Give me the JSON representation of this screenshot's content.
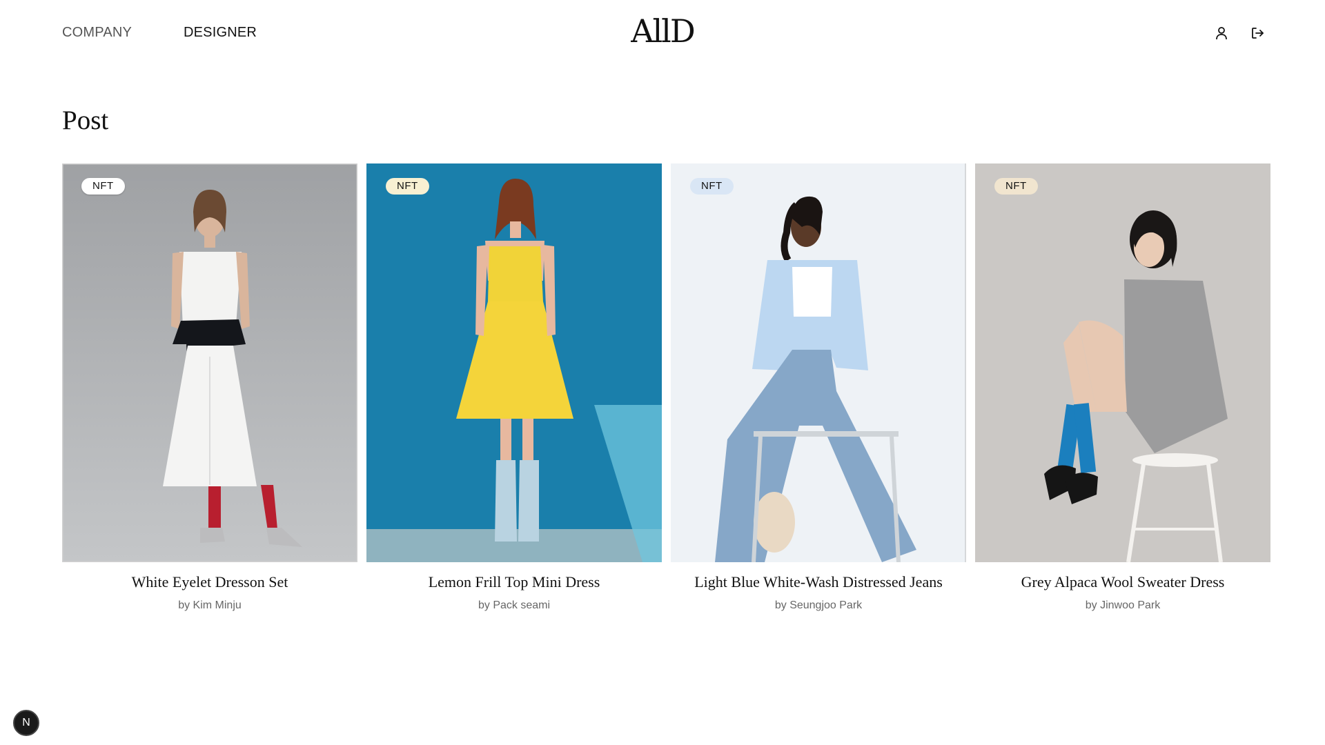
{
  "header": {
    "nav": [
      {
        "label": "COMPANY"
      },
      {
        "label": "DESIGNER"
      }
    ],
    "logo": "AllD",
    "icons": [
      "user-icon",
      "logout-icon"
    ]
  },
  "main": {
    "title": "Post",
    "posts": [
      {
        "badge": "NFT",
        "title": "White Eyelet Dresson Set",
        "author": "by Kim Minju",
        "image_bg": "#a7a8aa",
        "badge_bg": "#ffffff"
      },
      {
        "badge": "NFT",
        "title": "Lemon Frill Top Mini Dress",
        "author": "by Pack seami",
        "image_bg": "#1a7fab",
        "badge_bg": "#f8f0d2"
      },
      {
        "badge": "NFT",
        "title": "Light Blue White-Wash Distressed Jeans",
        "author": "by Seungjoo Park",
        "image_bg": "#eef2f6",
        "badge_bg": "#d9e6f5"
      },
      {
        "badge": "NFT",
        "title": "Grey Alpaca Wool Sweater Dress",
        "author": "by Jinwoo Park",
        "image_bg": "#cbc8c5",
        "badge_bg": "#f1e5cf"
      }
    ]
  },
  "dev_badge": {
    "label": "N"
  }
}
